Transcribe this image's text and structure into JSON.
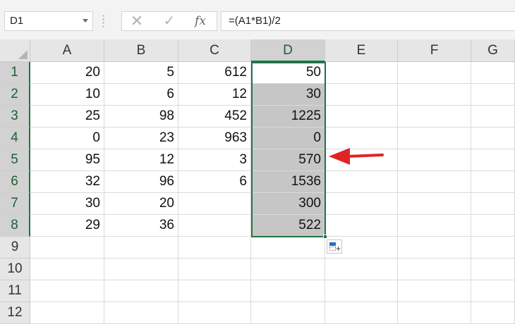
{
  "name_box": {
    "value": "D1"
  },
  "formula_bar": {
    "cancel_icon": "✕",
    "enter_icon": "✓",
    "fx_label": "fx",
    "formula": "=(A1*B1)/2"
  },
  "columns": [
    "A",
    "B",
    "C",
    "D",
    "E",
    "F",
    "G"
  ],
  "selected_column": "D",
  "rows": [
    "1",
    "2",
    "3",
    "4",
    "5",
    "6",
    "7",
    "8",
    "9",
    "10",
    "11",
    "12"
  ],
  "selected_rows": [
    "1",
    "2",
    "3",
    "4",
    "5",
    "6",
    "7",
    "8"
  ],
  "cells": [
    [
      "20",
      "5",
      "612",
      "50",
      "",
      "",
      ""
    ],
    [
      "10",
      "6",
      "12",
      "30",
      "",
      "",
      ""
    ],
    [
      "25",
      "98",
      "452",
      "1225",
      "",
      "",
      ""
    ],
    [
      "0",
      "23",
      "963",
      "0",
      "",
      "",
      ""
    ],
    [
      "95",
      "12",
      "3",
      "570",
      "",
      "",
      ""
    ],
    [
      "32",
      "96",
      "6",
      "1536",
      "",
      "",
      ""
    ],
    [
      "30",
      "20",
      "",
      "300",
      "",
      "",
      ""
    ],
    [
      "29",
      "36",
      "",
      "522",
      "",
      "",
      ""
    ],
    [
      "",
      "",
      "",
      "",
      "",
      "",
      ""
    ],
    [
      "",
      "",
      "",
      "",
      "",
      "",
      ""
    ],
    [
      "",
      "",
      "",
      "",
      "",
      "",
      ""
    ],
    [
      "",
      "",
      "",
      "",
      "",
      "",
      ""
    ]
  ],
  "colors": {
    "selection": "#217346",
    "shaded": "#c6c6c6",
    "arrow": "#e02424"
  },
  "icons": {
    "quick_analysis": "quick-analysis-icon",
    "annotation": "red-arrow-icon"
  }
}
